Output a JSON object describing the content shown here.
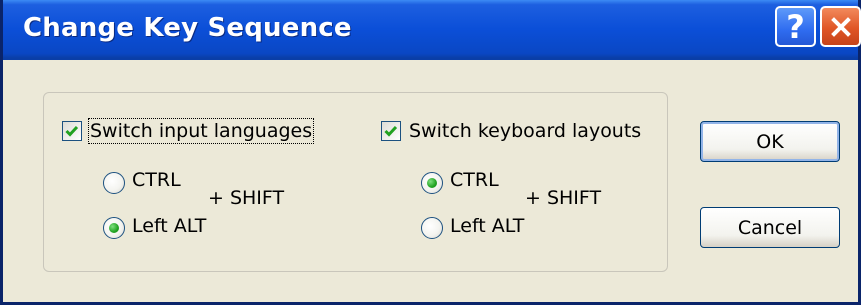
{
  "window": {
    "title": "Change Key Sequence",
    "help_glyph": "?",
    "close_icon": "close-icon"
  },
  "switch_input_languages": {
    "checkbox_label": "Switch input languages",
    "checked": true,
    "options": [
      {
        "label": "CTRL",
        "selected": false
      },
      {
        "label": "Left ALT",
        "selected": true
      }
    ],
    "plus_shift": "+  SHIFT"
  },
  "switch_keyboard_layouts": {
    "checkbox_label": "Switch keyboard layouts",
    "checked": true,
    "options": [
      {
        "label": "CTRL",
        "selected": true
      },
      {
        "label": "Left ALT",
        "selected": false
      }
    ],
    "plus_shift": "+  SHIFT"
  },
  "buttons": {
    "ok_label": "OK",
    "cancel_label": "Cancel"
  },
  "colors": {
    "titlebar": "#0b4fd8",
    "dialog_bg": "#ece9d8",
    "check_mark": "#21a121",
    "close_button": "#e05626"
  }
}
